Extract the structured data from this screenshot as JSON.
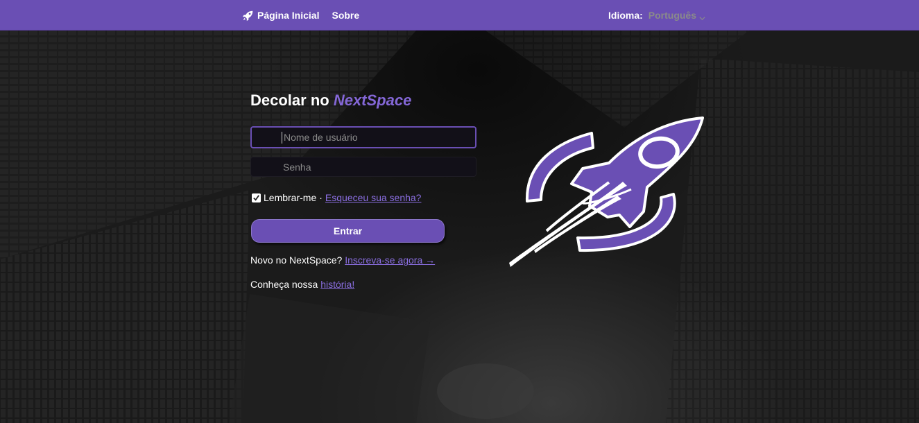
{
  "navbar": {
    "home_label": "Página Inicial",
    "about_label": "Sobre",
    "language_label": "Idioma:",
    "language_value": "Português"
  },
  "login": {
    "heading_prefix": "Decolar no",
    "heading_brand": "NextSpace",
    "username_placeholder": "Nome de usuário",
    "password_placeholder": "Senha",
    "remember_label": "Lembrar-me",
    "remember_checked": true,
    "separator": "·",
    "forgot_link": "Esqueceu sua senha?",
    "submit_label": "Entrar",
    "signup_prefix": "Novo no NextSpace?",
    "signup_link": "Inscreva-se agora →",
    "history_prefix": "Conheça nossa",
    "history_link": "história!"
  },
  "colors": {
    "accent": "#6a4fb4",
    "brand_text": "#8467d7",
    "link": "#8a6ee0",
    "background": "#151515"
  },
  "icons": {
    "nav_home": "rocket-icon",
    "language_dropdown": "chevron-down-icon",
    "remember": "checkbox-checked-icon",
    "logo": "rocket-logo"
  }
}
